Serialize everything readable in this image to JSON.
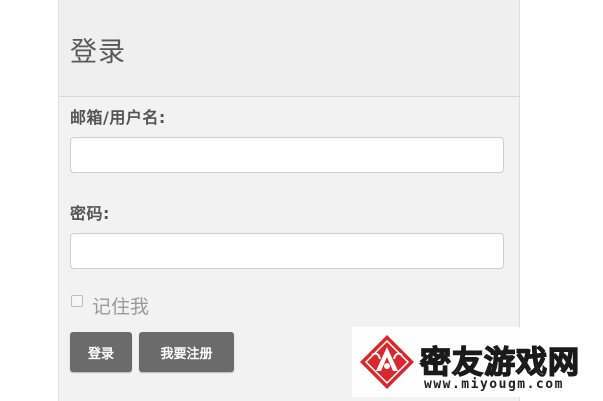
{
  "login_form": {
    "title": "登录",
    "username_label": "邮箱/用户名:",
    "username_value": "",
    "password_label": "密码:",
    "password_value": "",
    "remember_label": "记住我",
    "remember_checked": false,
    "login_button": "登录",
    "register_button": "我要注册"
  },
  "watermark": {
    "name": "密友游戏网",
    "url": "www.miyougm.com",
    "logo_icon": "red-diamond-logo-icon",
    "accent_color": "#d9272e"
  }
}
